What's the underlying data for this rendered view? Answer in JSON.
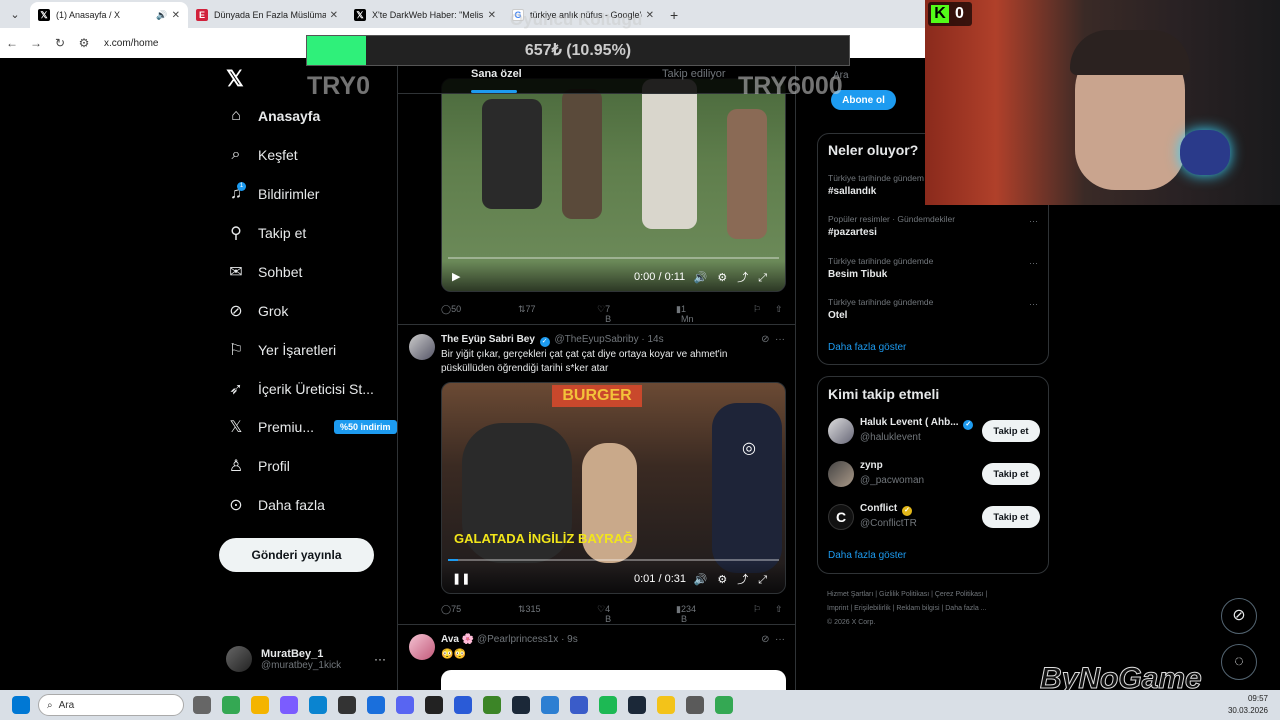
{
  "browser": {
    "tabs": [
      {
        "title": "(1) Anasayfa / X",
        "active": true,
        "audio": true
      },
      {
        "title": "Dünyada En Fazla Müslüman H...",
        "active": false
      },
      {
        "title": "X'te DarkWeb Haber: \"Melis İşi...",
        "active": false
      },
      {
        "title": "türkiye anlık nüfus - Google'da...",
        "active": false
      }
    ],
    "url": "x.com/home"
  },
  "overlay": {
    "donation_title": "Oyuncu Koltuğu",
    "donation_text": "657₺ (10.95%)",
    "donation_progress": 0.1095,
    "target_left": "TRY0",
    "target_right": "TRY6000",
    "kick_count": "0",
    "watermark": "ByNoGame"
  },
  "nav": {
    "items": [
      {
        "label": "Anasayfa",
        "icon": "home-icon"
      },
      {
        "label": "Keşfet",
        "icon": "search-icon"
      },
      {
        "label": "Bildirimler",
        "icon": "bell-icon",
        "badge": "1"
      },
      {
        "label": "Takip et",
        "icon": "add-person-icon"
      },
      {
        "label": "Sohbet",
        "icon": "mail-icon"
      },
      {
        "label": "Grok",
        "icon": "grok-icon"
      },
      {
        "label": "Yer İşaretleri",
        "icon": "bookmark-icon"
      },
      {
        "label": "İçerik Üreticisi St...",
        "icon": "rocket-icon"
      },
      {
        "label": "Premiu...",
        "icon": "x-premium-icon",
        "promo": "%50 indirim"
      },
      {
        "label": "Profil",
        "icon": "person-icon"
      },
      {
        "label": "Daha fazla",
        "icon": "more-circle-icon"
      }
    ],
    "post_button": "Gönderi yayınla",
    "account": {
      "name": "MuratBey_1",
      "handle": "@muratbey_1kick"
    }
  },
  "feed": {
    "tabs": [
      "Sana özel",
      "Takip ediliyor"
    ],
    "video1": {
      "time": "0:00 / 0:11",
      "progress": 0.0
    },
    "actions1": {
      "replies": "50",
      "reposts": "77",
      "likes": "7 B",
      "views": "1 Mn"
    },
    "tweet2": {
      "name": "The Eyüp Sabri Bey",
      "handle": "@TheEyupSabriby",
      "time": "· 14s",
      "text": "Bir yiğit çıkar, gerçekleri çat çat çat diye ortaya koyar ve ahmet'in püsküllüden öğrendiği tarihi s*ker atar",
      "video_caption": "GALATADA İNGİLİZ BAYRAĞ",
      "video_sign": "BURGER",
      "time_display": "0:01 / 0:31",
      "progress": 0.03,
      "replies": "75",
      "reposts": "315",
      "likes": "4 B",
      "views": "234 B"
    },
    "tweet3": {
      "name": "Ava 🌸",
      "handle": "@Pearlprincess1x",
      "time": "· 9s",
      "text": "😳😳"
    }
  },
  "sidebar": {
    "search_placeholder": "Ara",
    "subscribe_button": "Abone ol",
    "trends_title": "Neler oluyor?",
    "trends": [
      {
        "meta": "Türkiye tarihinde gündem",
        "name": "#sallandık"
      },
      {
        "meta": "Popüler resimler · Gündemdekiler",
        "name": "#pazartesi"
      },
      {
        "meta": "Türkiye tarihinde gündemde",
        "name": "Besim Tibuk"
      },
      {
        "meta": "Türkiye tarihinde gündemde",
        "name": "Otel"
      }
    ],
    "show_more": "Daha fazla göster",
    "who_title": "Kimi takip etmeli",
    "who": [
      {
        "name": "Haluk Levent ( Ahb...",
        "handle": "@haluklevent",
        "verified": "blue"
      },
      {
        "name": "zynp",
        "handle": "@_pacwoman"
      },
      {
        "name": "Conflict",
        "handle": "@ConflictTR",
        "verified": "gold"
      }
    ],
    "follow_label": "Takip et",
    "footer_line1": "Hizmet Şartları  |  Gizlilik Politikası  |  Çerez Politikası  |",
    "footer_line2": "Imprint  |  Erişilebilirlik  |  Reklam bilgisi  |  Daha fazla ...",
    "footer_line3": "© 2026 X Corp."
  },
  "taskbar": {
    "search_placeholder": "Ara",
    "time": "09:57",
    "date": "30.03.2026"
  }
}
